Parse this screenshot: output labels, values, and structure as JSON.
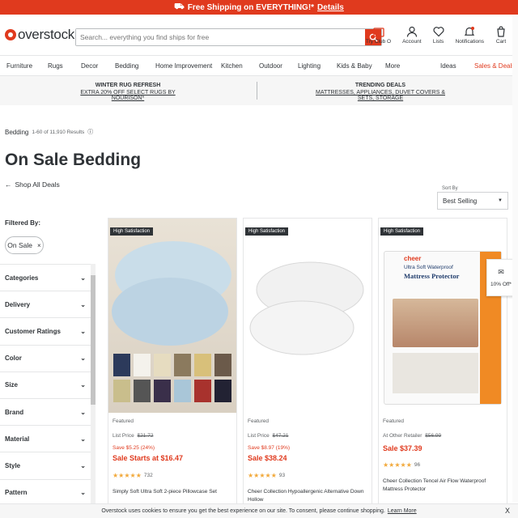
{
  "banner": {
    "text": "Free Shipping on EVERYTHING!*",
    "link": "Details"
  },
  "header": {
    "logo": "overstock",
    "search_placeholder": "Search... everything you find ships for free",
    "actions": [
      "Try Club O",
      "Account",
      "Lists",
      "Notifications",
      "Cart"
    ],
    "cart_count": "0"
  },
  "nav": [
    "Furniture",
    "Rugs",
    "Decor",
    "Bedding",
    "Home Improvement",
    "Kitchen",
    "Outdoor",
    "Lighting",
    "Kids & Baby",
    "More",
    "Ideas",
    "Sales & Deals"
  ],
  "promo": {
    "left_title": "WINTER RUG REFRESH",
    "left_sub": "EXTRA 20% OFF SELECT RUGS BY NOURISON*",
    "right_title": "TRENDING DEALS",
    "right_sub": "MATTRESSES, APPLIANCES, DUVET COVERS & SETS, STORAGE"
  },
  "page": {
    "breadcrumb": "Bedding",
    "results": "1-60 of 11,910 Results",
    "title": "On Sale Bedding",
    "back": "Shop All Deals",
    "sort_label": "Sort By",
    "sort_value": "Best Selling"
  },
  "filters": {
    "heading": "Filtered By:",
    "chip": "On Sale",
    "facets": [
      "Categories",
      "Delivery",
      "Customer Ratings",
      "Color",
      "Size",
      "Brand",
      "Material",
      "Style",
      "Pattern"
    ]
  },
  "products": [
    {
      "badge": "High Satisfaction",
      "featured": "Featured",
      "list_label": "List Price",
      "list_price": "$21.72",
      "save": "Save $5.25 (24%)",
      "sale": "Sale Starts at $16.47",
      "reviews": "732",
      "name": "Simply Soft Ultra Soft 2-piece Pillowcase Set"
    },
    {
      "badge": "High Satisfaction",
      "featured": "Featured",
      "list_label": "List Price",
      "list_price": "$47.21",
      "save": "Save $8.97 (19%)",
      "sale": "Sale $38.24",
      "reviews": "93",
      "name": "Cheer Collection Hypoallergenic Alternative Down Hollow"
    },
    {
      "badge": "High Satisfaction",
      "featured": "Featured",
      "list_label": "At Other Retailer",
      "list_price": "$56.99",
      "save": "",
      "sale": "Sale $37.39",
      "reviews": "96",
      "name": "Cheer Collection Tencel Air Flow Waterproof Mattress Protector"
    }
  ],
  "protector_box": {
    "brand": "cheer",
    "line1": "Ultra Soft Waterproof",
    "line2": "Mattress Protector"
  },
  "offer": "10% Off*",
  "cookie": {
    "text": "Overstock uses cookies to ensure you get the best experience on our site. To consent, please continue shopping.",
    "link": "Learn More",
    "close": "X"
  },
  "colors": {
    "brand": "#e03a1e"
  },
  "swatch_colors": [
    "#2c3a5b",
    "#f4f2ec",
    "#e6dcc0",
    "#8b7a5e",
    "#d8c07a",
    "#6b5a4a",
    "#c9be8c",
    "#555555",
    "#3a2f4a",
    "#a9c6d8",
    "#a8322d",
    "#222233"
  ]
}
